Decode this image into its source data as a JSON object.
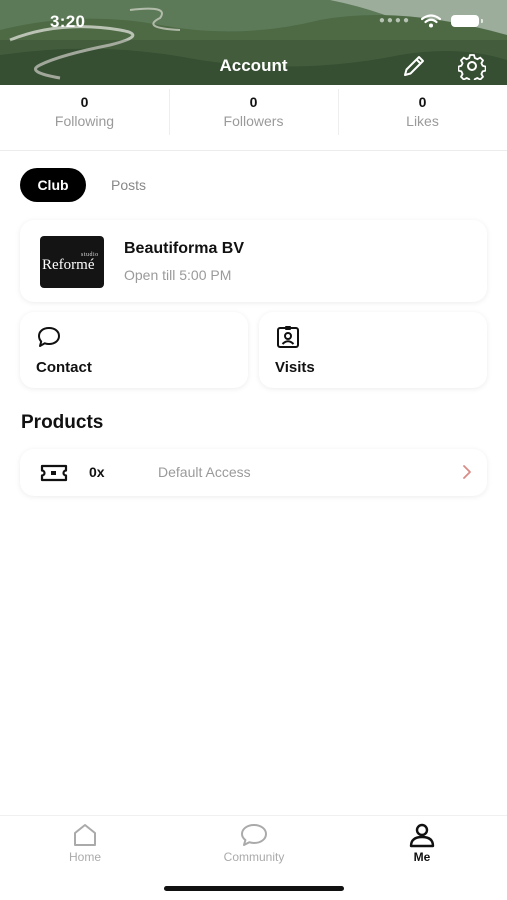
{
  "status_bar": {
    "time": "3:20"
  },
  "header": {
    "title": "Account"
  },
  "stats": [
    {
      "value": "0",
      "label": "Following"
    },
    {
      "value": "0",
      "label": "Followers"
    },
    {
      "value": "0",
      "label": "Likes"
    }
  ],
  "tabs": [
    {
      "label": "Club",
      "active": true
    },
    {
      "label": "Posts",
      "active": false
    }
  ],
  "club": {
    "name": "Beautiforma BV",
    "hours": "Open till 5:00 PM",
    "logo_text_small": "studio",
    "logo_text_big": "Reformé"
  },
  "actions": {
    "contact_label": "Contact",
    "visits_label": "Visits"
  },
  "products": {
    "title": "Products",
    "items": [
      {
        "count": "0x",
        "name": "Default Access"
      }
    ]
  },
  "bottom_nav": [
    {
      "label": "Home",
      "icon": "home-icon",
      "active": false
    },
    {
      "label": "Community",
      "icon": "chat-bubble-icon",
      "active": false
    },
    {
      "label": "Me",
      "icon": "person-icon",
      "active": true
    }
  ],
  "colors": {
    "accent": "#000000",
    "muted_text": "#9a9a9a",
    "chevron": "#d98b86"
  }
}
